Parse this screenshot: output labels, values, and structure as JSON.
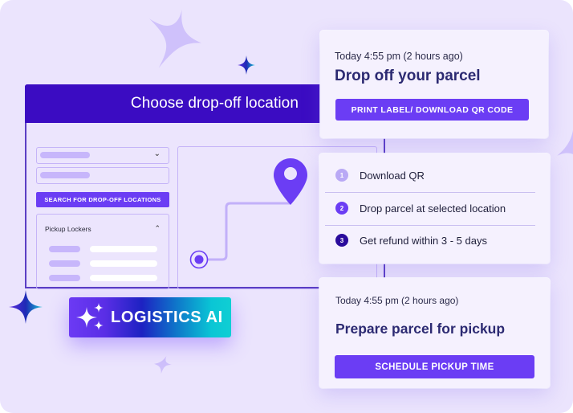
{
  "main_window": {
    "title": "Choose drop-off location",
    "search_button_label": "SEARCH FOR DROP-OFF LOCATIONS",
    "lockers_section_title": "Pickup Lockers",
    "dropdown_icon": "chevron-down-icon",
    "collapse_icon": "chevron-up-icon"
  },
  "map": {
    "destination_icon": "map-pin-icon",
    "origin_icon": "target-circle-icon"
  },
  "drop_off_card": {
    "timestamp": "Today 4:55 pm (2 hours ago)",
    "title": "Drop off your parcel",
    "button_label": "PRINT LABEL/ DOWNLOAD QR CODE"
  },
  "steps_card": {
    "steps": [
      {
        "number": "1",
        "label": "Download QR",
        "color": "#b9a9f5"
      },
      {
        "number": "2",
        "label": "Drop parcel at selected location",
        "color": "#6b3df4"
      },
      {
        "number": "3",
        "label": "Get refund within 3 - 5 days",
        "color": "#2a0b9c"
      }
    ]
  },
  "pickup_card": {
    "timestamp": "Today 4:55 pm (2 hours ago)",
    "title": "Prepare parcel for pickup",
    "button_label": "SCHEDULE PICKUP TIME"
  },
  "badge": {
    "label": "LOGISTICS AI",
    "icon": "sparkles-icon"
  },
  "colors": {
    "background": "#ebe4fd",
    "header": "#3b0cc2",
    "accent": "#6b3df4",
    "title_text": "#2c2a72"
  }
}
